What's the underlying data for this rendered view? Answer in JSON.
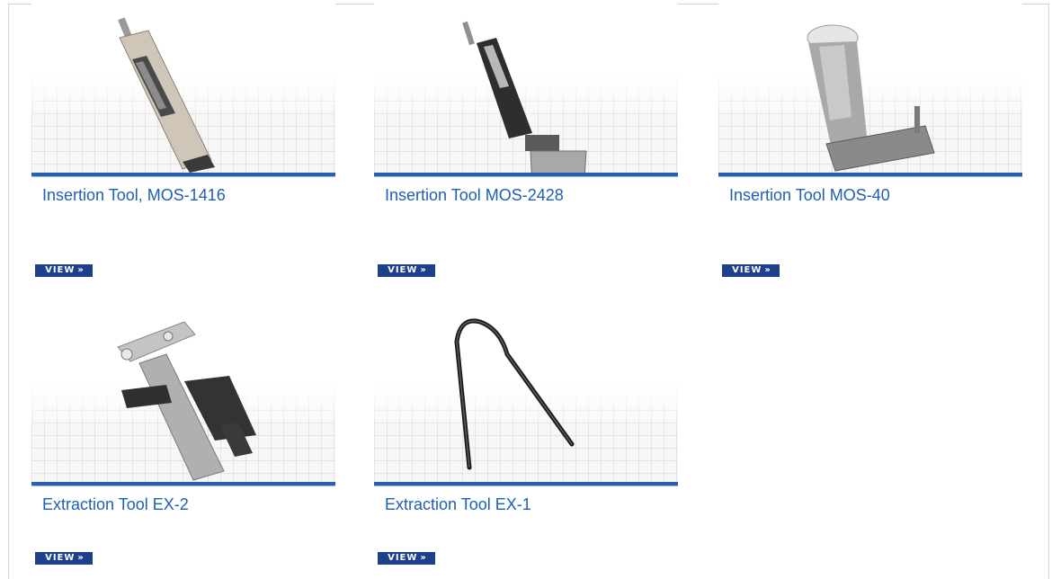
{
  "products": [
    {
      "title": "Insertion Tool, MOS-1416",
      "view_label": "VIEW",
      "image": "insertion-tool-mos-1416"
    },
    {
      "title": "Insertion Tool MOS-2428",
      "view_label": "VIEW",
      "image": "insertion-tool-mos-2428"
    },
    {
      "title": "Insertion Tool MOS-40",
      "view_label": "VIEW",
      "image": "insertion-tool-mos-40"
    },
    {
      "title": "Extraction Tool EX-2",
      "view_label": "VIEW",
      "image": "extraction-tool-ex-2"
    },
    {
      "title": "Extraction Tool EX-1",
      "view_label": "VIEW",
      "image": "extraction-tool-ex-1"
    }
  ],
  "colors": {
    "title_link": "#1f5fb4",
    "accent_bar": "#2b5fb0",
    "view_button": "#1e3f8a"
  },
  "icons": {
    "view_arrow": "double-chevron-right-icon"
  }
}
